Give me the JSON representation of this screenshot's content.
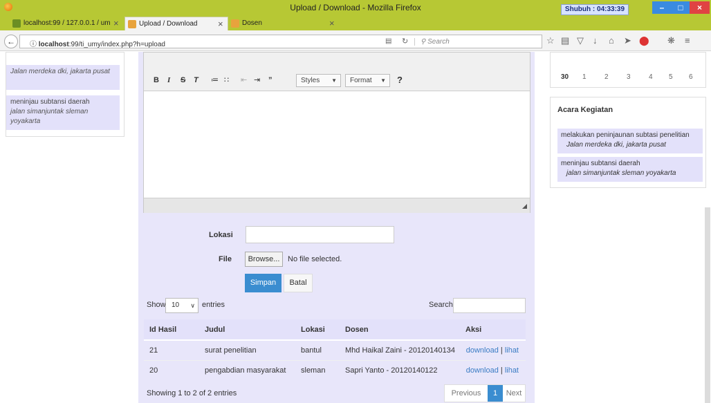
{
  "window": {
    "title": "Upload / Download - Mozilla Firefox",
    "clock": "Shubuh : 04:33:39"
  },
  "tabs": [
    {
      "label": "localhost:99 / 127.0.0.1 / um"
    },
    {
      "label": "Upload / Download"
    },
    {
      "label": "Dosen"
    }
  ],
  "nav": {
    "url_host": "localhost",
    "url_rest": ":99/ti_umy/index.php?h=upload",
    "search_placeholder": "Search"
  },
  "left_items": [
    {
      "title": "",
      "place": "Jalan merdeka dki, jakarta pusat"
    },
    {
      "title": "meninjau subtansi daerah",
      "place": "jalan simanjuntak sleman yoyakarta"
    }
  ],
  "editor": {
    "styles": "Styles",
    "format": "Format"
  },
  "form": {
    "lokasi_label": "Lokasi",
    "file_label": "File",
    "browse": "Browse...",
    "no_file": "No file selected.",
    "simpan": "Simpan",
    "batal": "Batal"
  },
  "table": {
    "show": "Show",
    "show_value": "10",
    "entries": "entries",
    "search": "Search:",
    "headers": [
      "Id Hasil",
      "Judul",
      "Lokasi",
      "Dosen",
      "Aksi"
    ],
    "rows": [
      {
        "id": "21",
        "judul": "surat penelitian",
        "lokasi": "bantul",
        "dosen": "Mhd Haikal Zaini - 20120140134",
        "download": "download",
        "sep": " | ",
        "lihat": "lihat"
      },
      {
        "id": "20",
        "judul": "pengabdian masyarakat",
        "lokasi": "sleman",
        "dosen": "Sapri Yanto - 20120140122",
        "download": "download",
        "sep": " | ",
        "lihat": "lihat"
      }
    ],
    "info": "Showing 1 to 2 of 2 entries",
    "prev": "Previous",
    "page": "1",
    "next": "Next"
  },
  "calendar": {
    "days": [
      "30",
      "1",
      "2",
      "3",
      "4",
      "5",
      "6"
    ]
  },
  "acara": {
    "title": "Acara Kegiatan",
    "items": [
      {
        "title": "melakukan peninjaunan subtasi penelitian",
        "place": "Jalan merdeka dki, jakarta pusat"
      },
      {
        "title": "meninjau subtansi daerah",
        "place": "jalan simanjuntak sleman yoyakarta"
      }
    ]
  },
  "colors": {
    "titlebar": "#b7c834",
    "panel": "#e8e6fa",
    "accent": "#3a8dd0"
  }
}
